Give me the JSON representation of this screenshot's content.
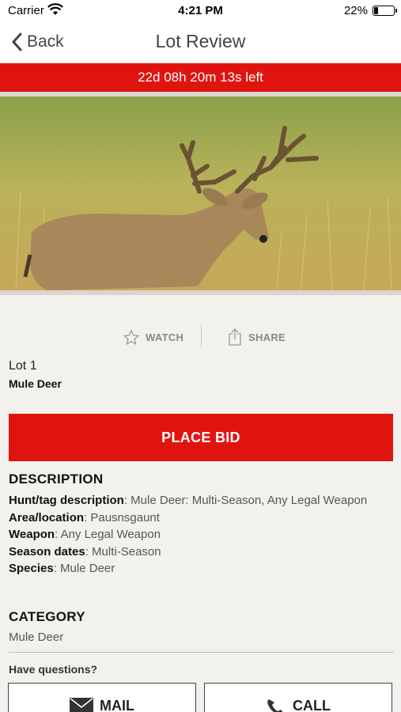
{
  "status_bar": {
    "carrier": "Carrier",
    "time": "4:21 PM",
    "battery_pct": "22%",
    "battery_level": 0.22
  },
  "nav": {
    "back_label": "Back",
    "title": "Lot Review"
  },
  "countdown": "22d 08h 20m 13s left",
  "actions": {
    "watch_label": "WATCH",
    "share_label": "SHARE"
  },
  "lot": {
    "number": "Lot 1",
    "name": "Mule Deer"
  },
  "place_bid_label": "PLACE BID",
  "description": {
    "title": "DESCRIPTION",
    "rows": [
      {
        "key": "Hunt/tag description",
        "value": ": Mule Deer: Multi-Season, Any Legal Weapon"
      },
      {
        "key": "Area/location",
        "value": ": Pausnsgaunt"
      },
      {
        "key": "Weapon",
        "value": ": Any Legal Weapon"
      },
      {
        "key": "Season dates",
        "value": ": Multi-Season"
      },
      {
        "key": "Species",
        "value": ": Mule Deer"
      }
    ]
  },
  "category": {
    "title": "CATEGORY",
    "value": "Mule Deer"
  },
  "questions_label": "Have questions?",
  "contact": {
    "mail_label": "MAIL",
    "call_label": "CALL"
  },
  "colors": {
    "accent_red": "#e0140f",
    "background": "#f3f1ed"
  }
}
